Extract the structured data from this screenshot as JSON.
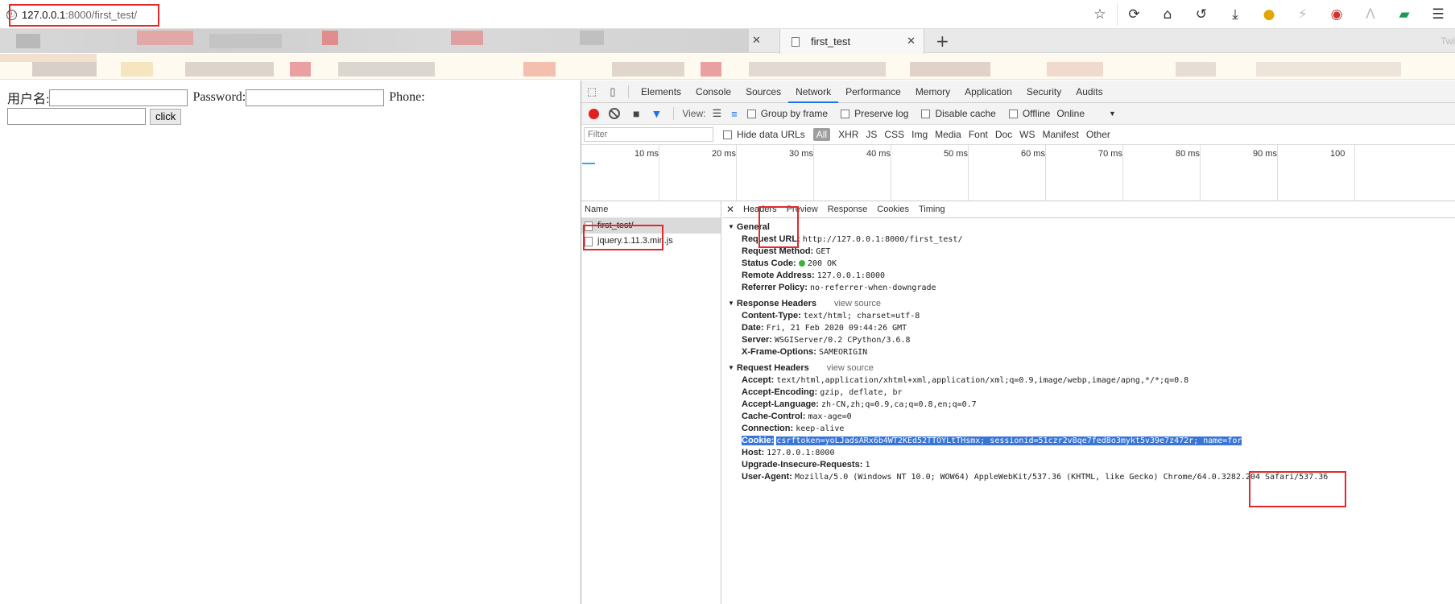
{
  "browser": {
    "url_host": "127.0.0.1",
    "url_path": ":8000/first_test/",
    "info_icon": "ⓘ",
    "toolbar_icons": [
      "star-icon",
      "sync-icon",
      "home-icon",
      "history-icon",
      "download-icon",
      "emoji-icon",
      "extension-icon",
      "extension-icon-2",
      "extension-icon-3",
      "extension-icon-4",
      "menu-icon"
    ],
    "tabs": [
      {
        "title": "first_test",
        "active": true
      }
    ],
    "tab_right_text": "Twi"
  },
  "page": {
    "username_label": "用户名:",
    "password_label": "Password:",
    "phone_label": "Phone:",
    "click_label": "click"
  },
  "devtools": {
    "tabs": [
      "Elements",
      "Console",
      "Sources",
      "Network",
      "Performance",
      "Memory",
      "Application",
      "Security",
      "Audits"
    ],
    "active_tab": "Network",
    "toolbar": {
      "view_label": "View:",
      "group_by_frame": "Group by frame",
      "preserve_log": "Preserve log",
      "disable_cache": "Disable cache",
      "offline": "Offline",
      "online": "Online"
    },
    "filter": {
      "placeholder": "Filter",
      "hide_data_urls": "Hide data URLs",
      "types": [
        "All",
        "XHR",
        "JS",
        "CSS",
        "Img",
        "Media",
        "Font",
        "Doc",
        "WS",
        "Manifest",
        "Other"
      ]
    },
    "timeline_ticks": [
      "10 ms",
      "20 ms",
      "30 ms",
      "40 ms",
      "50 ms",
      "60 ms",
      "70 ms",
      "80 ms",
      "90 ms",
      "100"
    ],
    "name_header": "Name",
    "requests": [
      {
        "name": "first_test/",
        "selected": true
      },
      {
        "name": "jquery.1.11.3.min.js",
        "selected": false
      }
    ],
    "detail_tabs": [
      "Headers",
      "Preview",
      "Response",
      "Cookies",
      "Timing"
    ],
    "general": {
      "title": "General",
      "rows": [
        {
          "k": "Request URL:",
          "v": "http://127.0.0.1:8000/first_test/"
        },
        {
          "k": "Request Method:",
          "v": "GET"
        },
        {
          "k": "Status Code:",
          "v": "200 OK"
        },
        {
          "k": "Remote Address:",
          "v": "127.0.0.1:8000"
        },
        {
          "k": "Referrer Policy:",
          "v": "no-referrer-when-downgrade"
        }
      ]
    },
    "response_headers": {
      "title": "Response Headers",
      "view_source": "view source",
      "rows": [
        {
          "k": "Content-Type:",
          "v": "text/html; charset=utf-8"
        },
        {
          "k": "Date:",
          "v": "Fri, 21 Feb 2020 09:44:26 GMT"
        },
        {
          "k": "Server:",
          "v": "WSGIServer/0.2 CPython/3.6.8"
        },
        {
          "k": "X-Frame-Options:",
          "v": "SAMEORIGIN"
        }
      ]
    },
    "request_headers": {
      "title": "Request Headers",
      "view_source": "view source",
      "rows": [
        {
          "k": "Accept:",
          "v": "text/html,application/xhtml+xml,application/xml;q=0.9,image/webp,image/apng,*/*;q=0.8"
        },
        {
          "k": "Accept-Encoding:",
          "v": "gzip, deflate, br"
        },
        {
          "k": "Accept-Language:",
          "v": "zh-CN,zh;q=0.9,ca;q=0.8,en;q=0.7"
        },
        {
          "k": "Cache-Control:",
          "v": "max-age=0"
        },
        {
          "k": "Connection:",
          "v": "keep-alive"
        },
        {
          "k": "Cookie:",
          "v": "csrftoken=yoLJadsARx6b4WT2KEd52TTOYLtTHsmx; sessionid=51czr2v8qe7fed8o3mykt5v39e7z472r; name=for",
          "highlight": true
        },
        {
          "k": "Host:",
          "v": "127.0.0.1:8000"
        },
        {
          "k": "Upgrade-Insecure-Requests:",
          "v": "1"
        },
        {
          "k": "User-Agent:",
          "v": "Mozilla/5.0 (Windows NT 10.0; WOW64) AppleWebKit/537.36 (KHTML, like Gecko) Chrome/64.0.3282.204 Safari/537.36"
        }
      ]
    }
  },
  "colors": {
    "annotation_red": "#e2282b",
    "selection_blue": "#3875d7",
    "record_red": "#e02020",
    "status_green": "#3bb33b"
  }
}
